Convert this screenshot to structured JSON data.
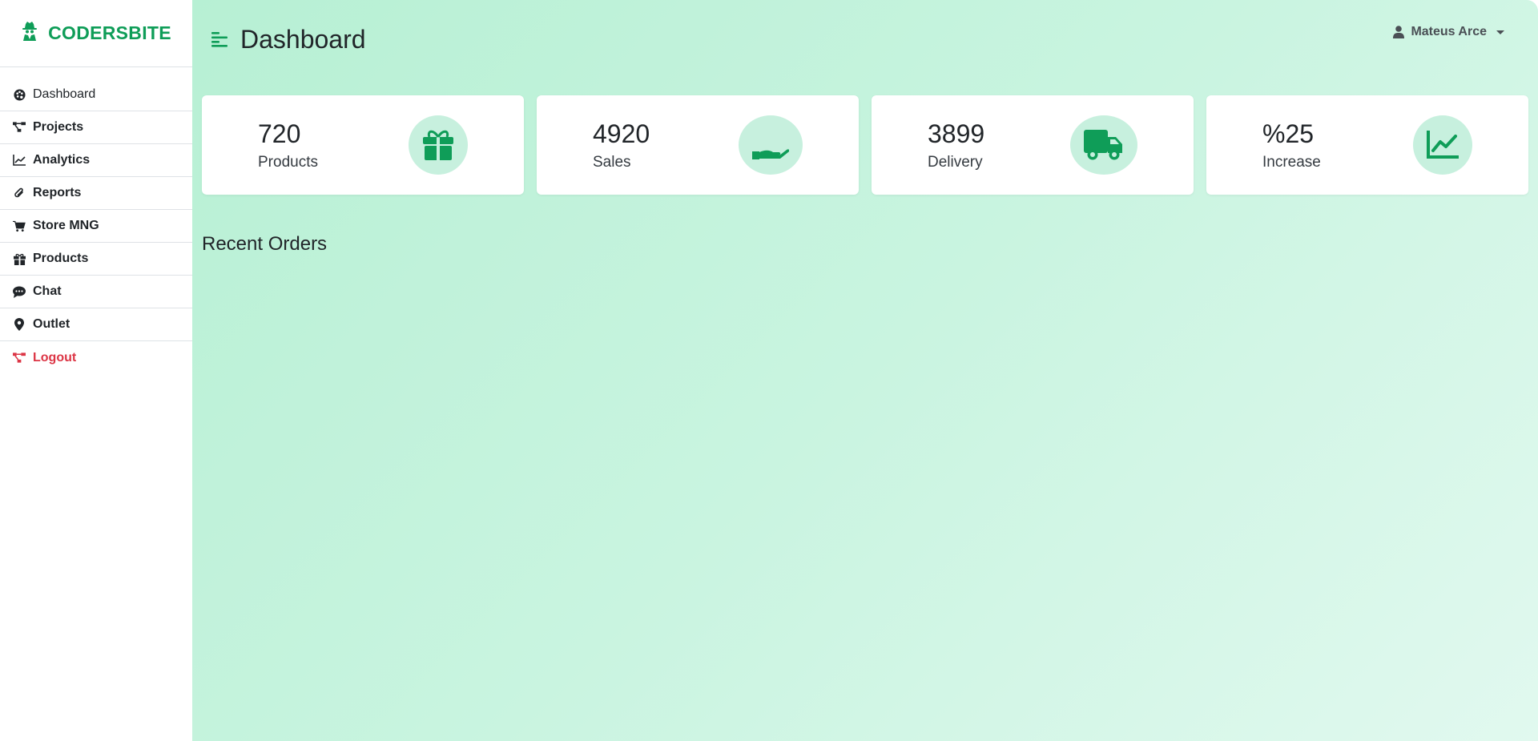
{
  "brand": {
    "name": "CODERSBITE",
    "icon": "user-secret-icon"
  },
  "sidebar": {
    "items": [
      {
        "label": "Dashboard",
        "icon": "palette-icon"
      },
      {
        "label": "Projects",
        "icon": "project-diagram-icon"
      },
      {
        "label": "Analytics",
        "icon": "chart-line-icon"
      },
      {
        "label": "Reports",
        "icon": "paperclip-icon"
      },
      {
        "label": "Store MNG",
        "icon": "shopping-cart-icon"
      },
      {
        "label": "Products",
        "icon": "gift-icon"
      },
      {
        "label": "Chat",
        "icon": "comment-dots-icon"
      },
      {
        "label": "Outlet",
        "icon": "map-marker-icon"
      },
      {
        "label": "Logout",
        "icon": "project-diagram-icon"
      }
    ]
  },
  "header": {
    "title": "Dashboard",
    "menu_icon": "align-left-icon",
    "user_name": "Mateus Arce",
    "user_icon": "user-icon"
  },
  "cards": [
    {
      "value": "720",
      "label": "Products",
      "icon": "gift-icon"
    },
    {
      "value": "4920",
      "label": "Sales",
      "icon": "hand-holding-usd-icon"
    },
    {
      "value": "3899",
      "label": "Delivery",
      "icon": "truck-icon"
    },
    {
      "value": "%25",
      "label": "Increase",
      "icon": "chart-line-icon"
    }
  ],
  "recent_orders": {
    "title": "Recent Orders"
  },
  "colors": {
    "brand": "#0f9d58",
    "logout": "#dc3545",
    "icon_bg": "#c7f0de",
    "gradient_start": "#b7f0d4",
    "gradient_end": "#e1f9ef"
  }
}
